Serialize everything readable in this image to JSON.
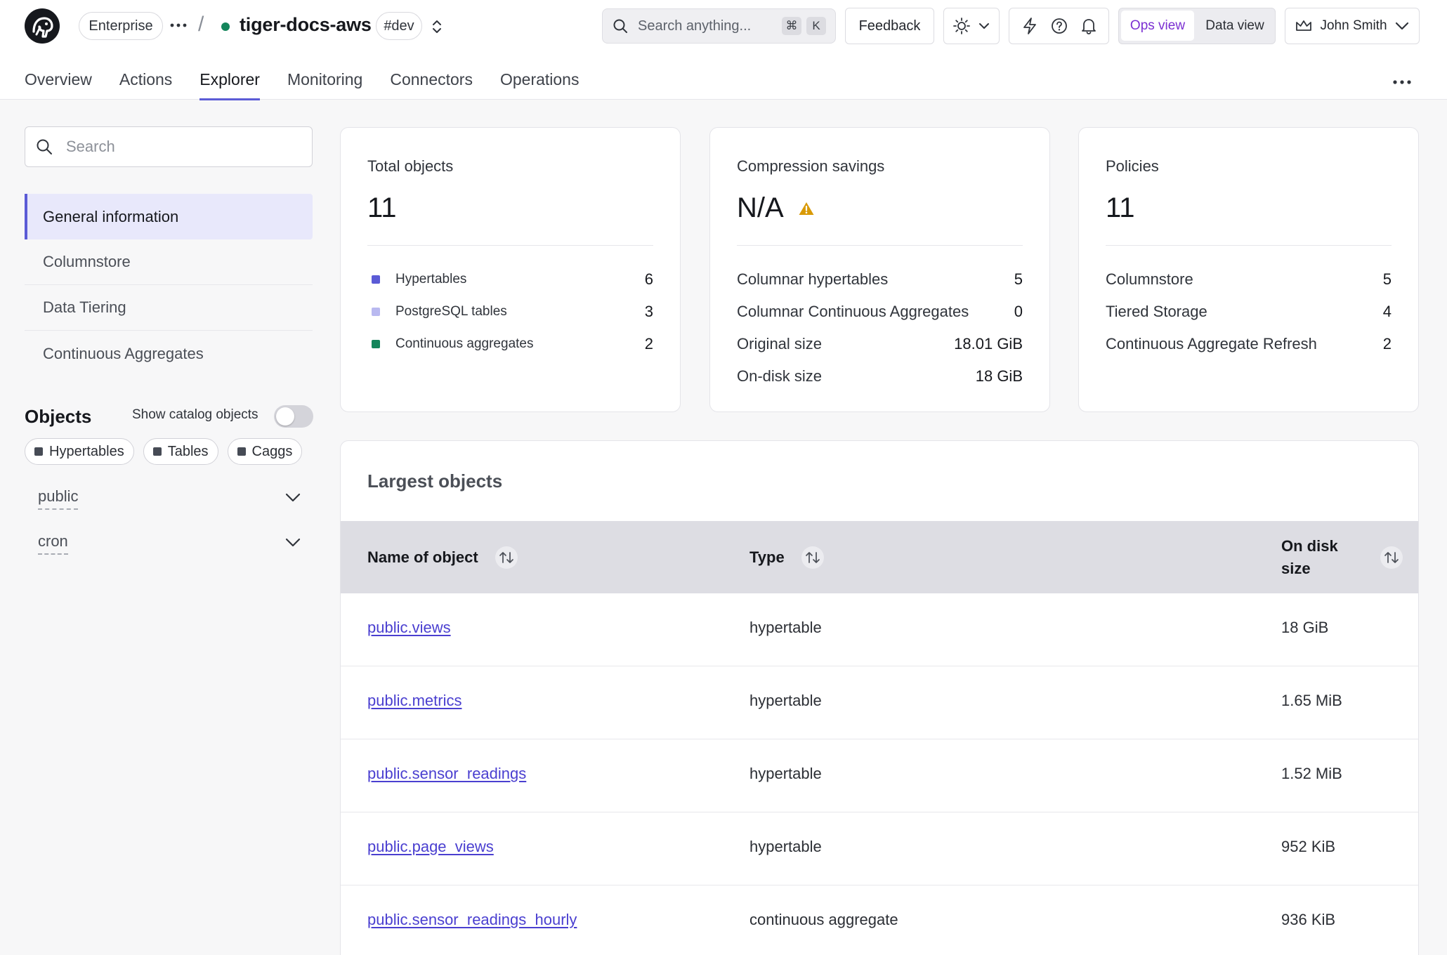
{
  "header": {
    "plan": "Enterprise",
    "separator": "/",
    "service_name": "tiger-docs-aws",
    "branch": "#dev",
    "search_placeholder": "Search anything...",
    "shortcut_cmd": "⌘",
    "shortcut_key": "K",
    "feedback_label": "Feedback",
    "ops_view_label": "Ops view",
    "data_view_label": "Data view",
    "user_name": "John Smith",
    "status_color": "#14855b",
    "accent_color": "#5b5bd6"
  },
  "tabs": [
    {
      "label": "Overview"
    },
    {
      "label": "Actions"
    },
    {
      "label": "Explorer"
    },
    {
      "label": "Monitoring"
    },
    {
      "label": "Connectors"
    },
    {
      "label": "Operations"
    }
  ],
  "sidebar": {
    "search_placeholder": "Search",
    "nav": [
      {
        "label": "General information"
      },
      {
        "label": "Columnstore"
      },
      {
        "label": "Data Tiering"
      },
      {
        "label": "Continuous Aggregates"
      }
    ],
    "objects_title": "Objects",
    "catalog_toggle_label": "Show catalog objects",
    "filters": [
      {
        "label": "Hypertables"
      },
      {
        "label": "Tables"
      },
      {
        "label": "Caggs"
      }
    ],
    "schemas": [
      {
        "name": "public"
      },
      {
        "name": "cron"
      }
    ]
  },
  "cards": {
    "total_objects": {
      "title": "Total objects",
      "value": "11",
      "rows": [
        {
          "label": "Hypertables",
          "value": "6",
          "color": "#5b5bd6"
        },
        {
          "label": "PostgreSQL tables",
          "value": "3",
          "color": "#b9b9f0"
        },
        {
          "label": "Continuous aggregates",
          "value": "2",
          "color": "#14855b"
        }
      ]
    },
    "compression": {
      "title": "Compression savings",
      "value": "N/A",
      "warning_color": "#d99a06",
      "rows": [
        {
          "label": "Columnar hypertables",
          "value": "5"
        },
        {
          "label": "Columnar Continuous Aggregates",
          "value": "0"
        },
        {
          "label": "Original size",
          "value": "18.01 GiB"
        },
        {
          "label": "On-disk size",
          "value": "18 GiB"
        }
      ]
    },
    "policies": {
      "title": "Policies",
      "value": "11",
      "rows": [
        {
          "label": "Columnstore",
          "value": "5"
        },
        {
          "label": "Tiered Storage",
          "value": "4"
        },
        {
          "label": "Continuous Aggregate Refresh",
          "value": "2"
        }
      ]
    }
  },
  "largest": {
    "title": "Largest objects",
    "columns": {
      "name": "Name of object",
      "type": "Type",
      "size_line1": "On disk",
      "size_line2": "size"
    },
    "rows": [
      {
        "name": "public.views",
        "type": "hypertable",
        "size": "18 GiB"
      },
      {
        "name": "public.metrics",
        "type": "hypertable",
        "size": "1.65 MiB"
      },
      {
        "name": "public.sensor_readings",
        "type": "hypertable",
        "size": "1.52 MiB"
      },
      {
        "name": "public.page_views",
        "type": "hypertable",
        "size": "952 KiB"
      },
      {
        "name": "public.sensor_readings_hourly",
        "type": "continuous aggregate",
        "size": "936 KiB"
      }
    ]
  }
}
